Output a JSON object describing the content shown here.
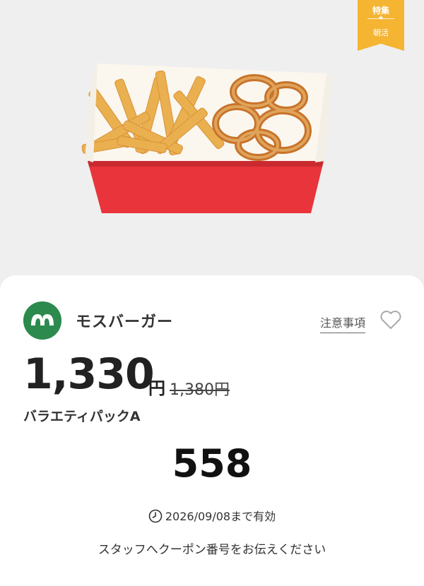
{
  "badge": {
    "label_top": "特集",
    "label_bottom": "朝活"
  },
  "product": {
    "image": "french-fries-and-onion-rings-in-red-box",
    "brand": "モスバーガー",
    "notes_link": "注意事項",
    "price": "1,330",
    "currency": "円",
    "original_price": "1,380円",
    "name": "バラエティパックA"
  },
  "coupon": {
    "number": "558",
    "validity": "2026/09/08まで有効",
    "instruction": "スタッフへクーポン番号をお伝えください"
  },
  "colors": {
    "badge": "#f5b431",
    "brand_green": "#2c8a4f",
    "box_red": "#e8343a"
  },
  "icons": [
    "clock-icon",
    "heart-icon",
    "mos-logo"
  ]
}
